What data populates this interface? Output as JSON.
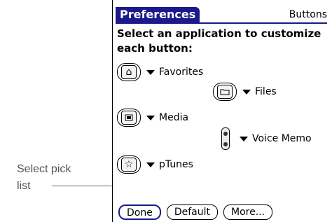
{
  "callout": {
    "text_line1": "Select pick",
    "text_line2": "list"
  },
  "header": {
    "title": "Preferences",
    "right_label": "Buttons"
  },
  "instructions": "Select an application to customize each button:",
  "assignments": [
    {
      "icon": "home-icon",
      "label": "Favorites"
    },
    {
      "icon": "folder-icon",
      "label": "Files"
    },
    {
      "icon": "media-icon",
      "label": "Media"
    },
    {
      "icon": "voice-memo-side-button-icon",
      "label": "Voice Memo"
    },
    {
      "icon": "star-icon",
      "label": "pTunes"
    }
  ],
  "buttons": {
    "done": "Done",
    "default": "Default",
    "more": "More..."
  },
  "colors": {
    "accent": "#1a1a8c",
    "background": "#ffffff",
    "text": "#000000",
    "callout_text": "#555555"
  }
}
